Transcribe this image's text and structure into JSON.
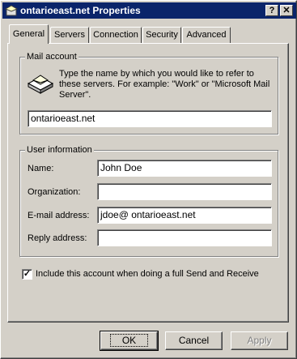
{
  "window": {
    "title": "ontarioeast.net  Properties",
    "help_label": "?",
    "close_label": "✕"
  },
  "tabs": [
    {
      "label": "General",
      "active": true
    },
    {
      "label": "Servers",
      "active": false
    },
    {
      "label": "Connection",
      "active": false
    },
    {
      "label": "Security",
      "active": false
    },
    {
      "label": "Advanced",
      "active": false
    }
  ],
  "mail_account": {
    "legend": "Mail account",
    "description": "Type the name by which you would like to refer to these servers.  For example: \"Work\" or \"Microsoft Mail Server\".",
    "name_value": "ontarioeast.net",
    "icon": "mail-server-icon"
  },
  "user_info": {
    "legend": "User information",
    "name_label": "Name:",
    "name_value": "John Doe",
    "org_label": "Organization:",
    "org_value": "",
    "email_label": "E-mail address:",
    "email_value": "jdoe@ ontarioeast.net",
    "reply_label": "Reply address:",
    "reply_value": ""
  },
  "include_checkbox": {
    "label": "Include this account when doing a full Send and Receive",
    "checked": true,
    "check_glyph": "✓"
  },
  "buttons": {
    "ok": "OK",
    "cancel": "Cancel",
    "apply": "Apply"
  }
}
